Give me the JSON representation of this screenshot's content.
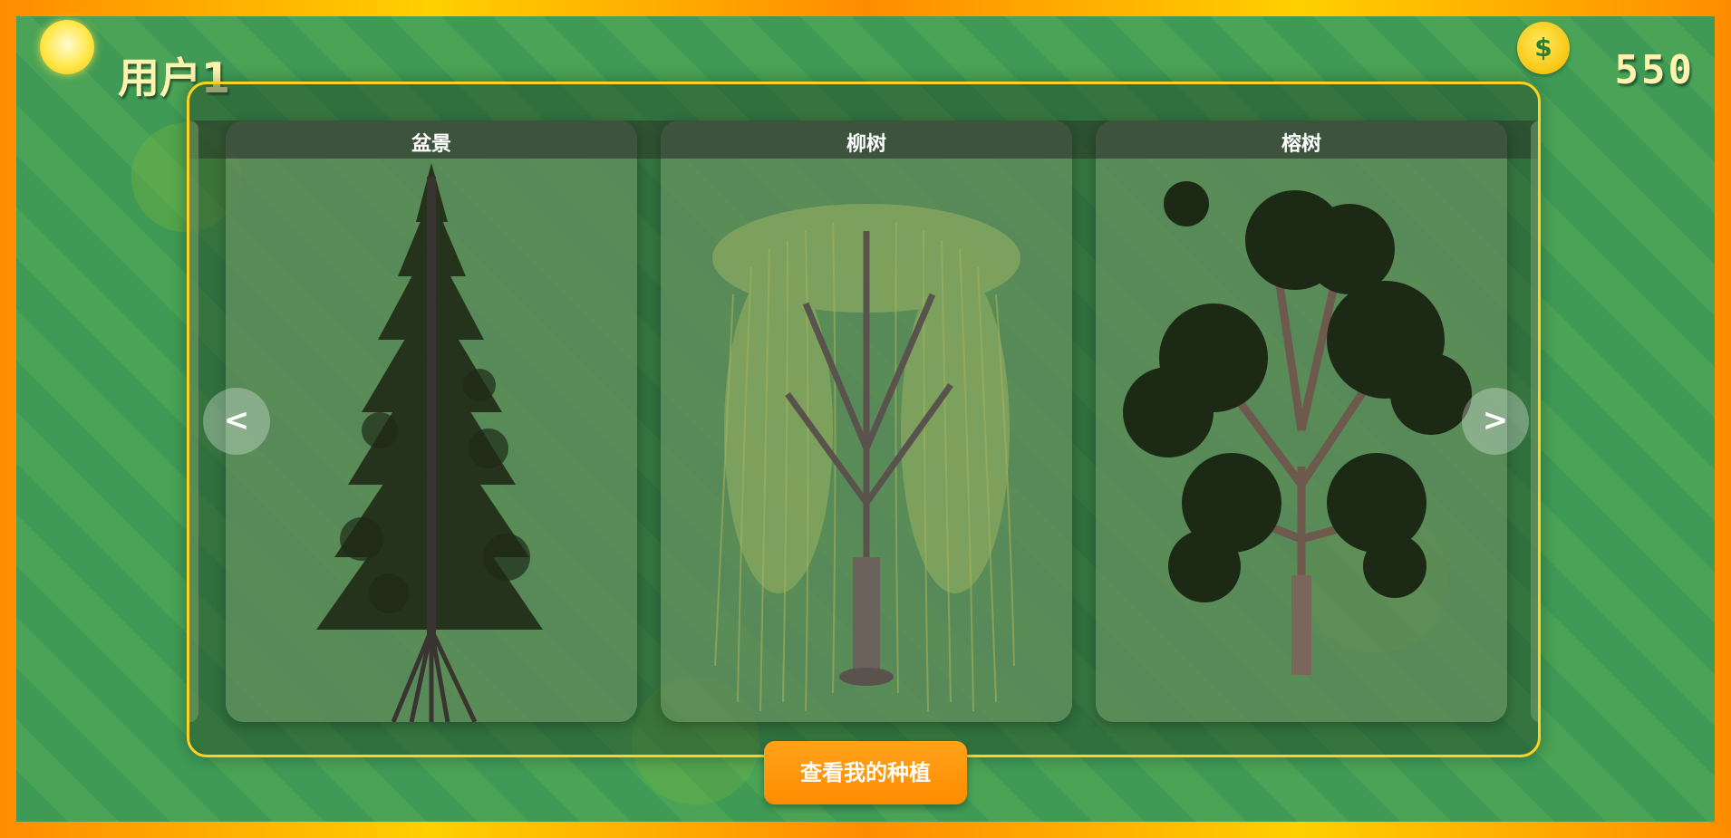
{
  "player": {
    "name": "用户1",
    "coins": "550"
  },
  "icons": {
    "sun": "sun-icon",
    "coin": "dollar-coin-icon",
    "coin_symbol": "$"
  },
  "carousel": {
    "prev_label": "<",
    "next_label": ">",
    "cards": [
      {
        "title": "盆景",
        "tree": "spruce-tree"
      },
      {
        "title": "柳树",
        "tree": "willow-tree"
      },
      {
        "title": "榕树",
        "tree": "banyan-tree"
      }
    ]
  },
  "actions": {
    "view_my_planting": "查看我的种植"
  },
  "colors": {
    "accent_gold": "#ffd21f",
    "button_orange": "#ff8c00",
    "field_green": "#3f9a55"
  }
}
